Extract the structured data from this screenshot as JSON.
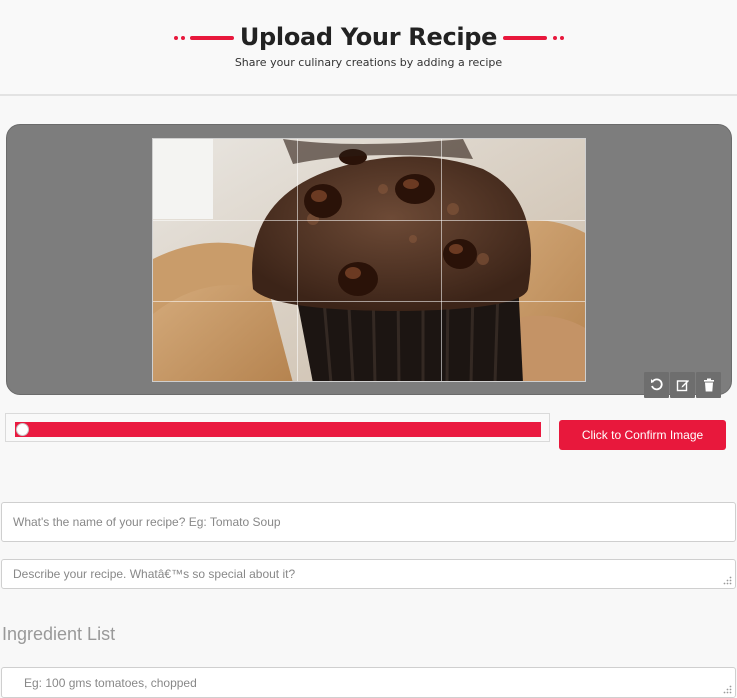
{
  "header": {
    "title": "Upload Your Recipe",
    "subtitle": "Share your culinary creations by adding a recipe",
    "accent_color": "#e8183c"
  },
  "cropper": {
    "image_alt": "chocolate chip muffin",
    "tools": [
      {
        "icon": "rotate-icon"
      },
      {
        "icon": "edit-icon"
      },
      {
        "icon": "trash-icon"
      }
    ]
  },
  "zoom": {
    "value": 0
  },
  "confirm_button": {
    "label": "Click to Confirm Image"
  },
  "form": {
    "name_placeholder": "What's the name of your recipe? Eg: Tomato Soup",
    "description_placeholder": "Describe your recipe. Whatâ€™s so special about it?",
    "ingredients_title": "Ingredient List",
    "ingredient_placeholder": "Eg: 100 gms tomatoes, chopped"
  }
}
